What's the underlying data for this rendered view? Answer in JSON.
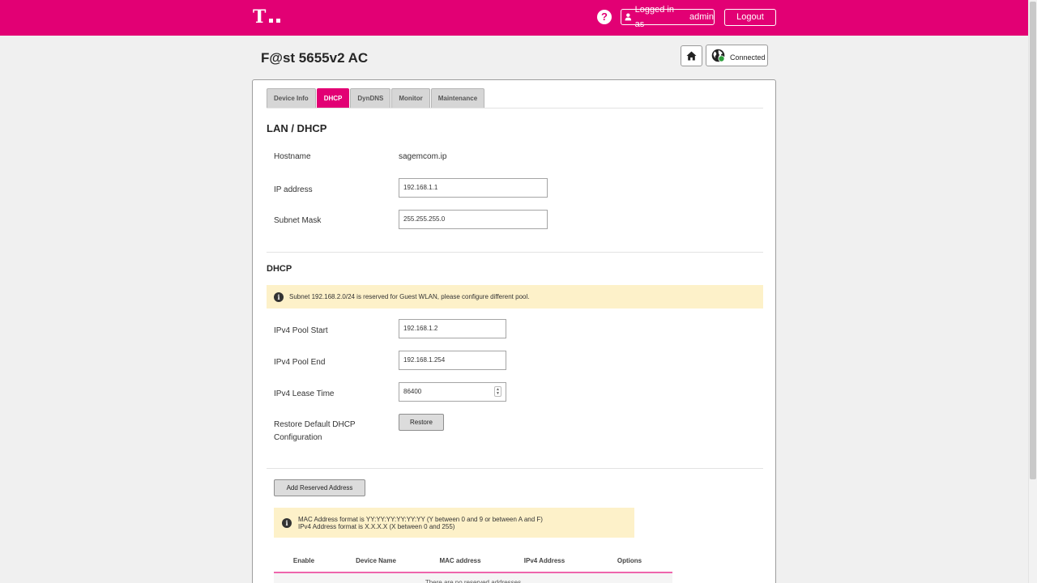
{
  "header": {
    "help_glyph": "?",
    "logged_in_label": "Logged in as",
    "username": "admin",
    "logout_label": "Logout",
    "brand_color": "#e20074"
  },
  "page": {
    "title": "F@st 5655v2 AC",
    "connection_label": "Connected"
  },
  "tabs": [
    {
      "label": "Device Info",
      "active": false
    },
    {
      "label": "DHCP",
      "active": true
    },
    {
      "label": "DynDNS",
      "active": false
    },
    {
      "label": "Monitor",
      "active": false
    },
    {
      "label": "Maintenance",
      "active": false
    }
  ],
  "lan": {
    "title": "LAN / DHCP",
    "hostname_label": "Hostname",
    "hostname_value": "sagemcom.ip",
    "ip_label": "IP address",
    "ip_value": "192.168.1.1",
    "mask_label": "Subnet Mask",
    "mask_value": "255.255.255.0"
  },
  "dhcp": {
    "title": "DHCP",
    "notice": "Subnet 192.168.2.0/24 is reserved for Guest WLAN, please configure different pool.",
    "pool_start_label": "IPv4 Pool Start",
    "pool_start_value": "192.168.1.2",
    "pool_end_label": "IPv4 Pool End",
    "pool_end_value": "192.168.1.254",
    "lease_label": "IPv4 Lease Time",
    "lease_value": "86400",
    "restore_label_line1": "Restore Default DHCP",
    "restore_label_line2": "Configuration",
    "restore_button": "Restore"
  },
  "reserved": {
    "add_button": "Add Reserved Address",
    "notice_line1": "MAC Address format is YY:YY:YY:YY:YY:YY (Y between 0 and 9 or between A and F)",
    "notice_line2": "IPv4 Address format is X.X.X.X (X between 0 and 255)",
    "columns": [
      "Enable",
      "Device Name",
      "MAC address",
      "IPv4 Address",
      "Options"
    ],
    "empty_text": "There are no reserved addresses"
  }
}
